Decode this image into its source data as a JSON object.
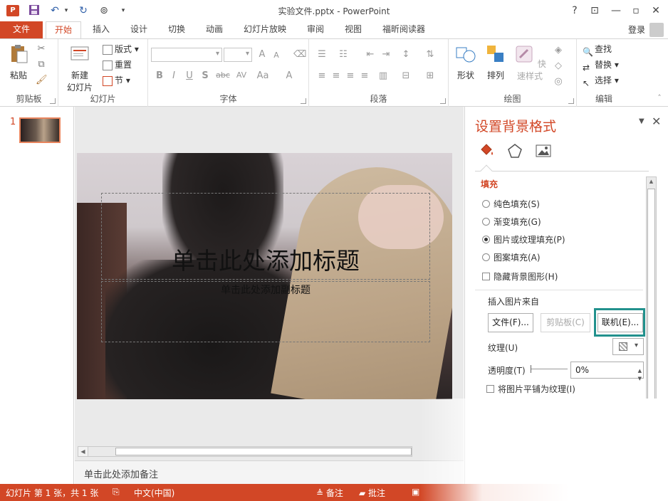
{
  "titlebar": {
    "app_icon": "P",
    "doc_title": "实验文件.pptx - PowerPoint",
    "help": "?",
    "minimize": "—",
    "restore": "▫",
    "close": "✕"
  },
  "tabs": [
    "文件",
    "开始",
    "插入",
    "设计",
    "切换",
    "动画",
    "幻灯片放映",
    "审阅",
    "视图",
    "福昕阅读器"
  ],
  "login": "登录",
  "ribbon": {
    "clipboard": {
      "paste": "粘贴",
      "label": "剪贴板"
    },
    "slides": {
      "new_slide": "新建\n幻灯片",
      "new_slide_line1": "新建",
      "new_slide_line2": "幻灯片",
      "layout": "版式",
      "reset": "重置",
      "section": "节",
      "label": "幻灯片"
    },
    "font": {
      "label": "字体",
      "bold": "B",
      "italic": "I",
      "underline": "U",
      "shadow": "S",
      "strike": "abc",
      "spacing": "AV",
      "case": "Aa",
      "color": "A",
      "grow": "A",
      "shrink": "A"
    },
    "paragraph": {
      "label": "段落"
    },
    "drawing": {
      "shapes": "形状",
      "arrange": "排列",
      "quick_styles": "快速样式",
      "label": "绘图"
    },
    "editing": {
      "find": "查找",
      "replace": "替换",
      "select": "选择",
      "label": "编辑"
    }
  },
  "thumbs": {
    "number": "1"
  },
  "slide": {
    "title_placeholder": "单击此处添加标题",
    "subtitle_placeholder": "单击此处添加副标题"
  },
  "notes": "单击此处添加备注",
  "format_pane": {
    "title": "设置背景格式",
    "fill_header": "填充",
    "options": [
      {
        "label": "纯色填充(S)",
        "checked": false
      },
      {
        "label": "渐变填充(G)",
        "checked": false
      },
      {
        "label": "图片或纹理填充(P)",
        "checked": true
      },
      {
        "label": "图案填充(A)",
        "checked": false
      }
    ],
    "hide_bg": "隐藏背景图形(H)",
    "insert_from": "插入图片来自",
    "btn_file": "文件(F)...",
    "btn_clipboard": "剪贴板(C)",
    "btn_online": "联机(E)...",
    "texture_label": "纹理(U)",
    "transparency_label": "透明度(T)",
    "transparency_value": "0%",
    "tile_label": "将图片平铺为纹理(I)"
  },
  "statusbar": {
    "slide_info": "幻灯片 第 1 张，共 1 张",
    "language": "中文(中国)",
    "notes": "备注",
    "comments": "批注"
  },
  "colors": {
    "accent": "#d24726",
    "highlight": "#22918d"
  }
}
